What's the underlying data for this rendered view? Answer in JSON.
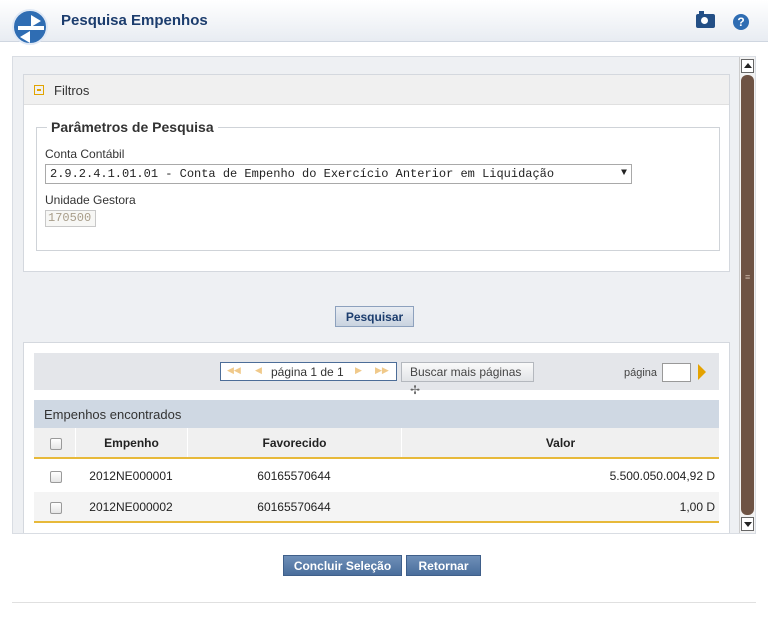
{
  "window": {
    "title": "Pesquisa Empenhos"
  },
  "filters": {
    "header_label": "Filtros",
    "legend": "Parâmetros de Pesquisa",
    "conta_label": "Conta Contábil",
    "conta_value": "2.9.2.4.1.01.01 - Conta de Empenho do Exercício Anterior em Liquidação",
    "ug_label": "Unidade Gestora",
    "ug_value": "170500"
  },
  "actions": {
    "pesquisar": "Pesquisar",
    "concluir": "Concluir Seleção",
    "retornar": "Retornar"
  },
  "pager": {
    "text": "página 1 de 1",
    "buscar": "Buscar mais páginas",
    "page_label": "página",
    "page_value": ""
  },
  "table": {
    "caption": "Empenhos encontrados",
    "headers": [
      "Empenho",
      "Favorecido",
      "Valor"
    ],
    "rows": [
      {
        "empenho": "2012NE000001",
        "favorecido": "60165570644",
        "valor": "5.500.050.004,92 D"
      },
      {
        "empenho": "2012NE000002",
        "favorecido": "60165570644",
        "valor": "1,00 D"
      }
    ]
  },
  "icons": [
    "siafi-logo-icon",
    "camera-icon",
    "help-icon",
    "collapse-icon",
    "first-page-icon",
    "prev-page-icon",
    "next-page-icon",
    "last-page-icon",
    "plus-icon",
    "go-page-icon"
  ]
}
